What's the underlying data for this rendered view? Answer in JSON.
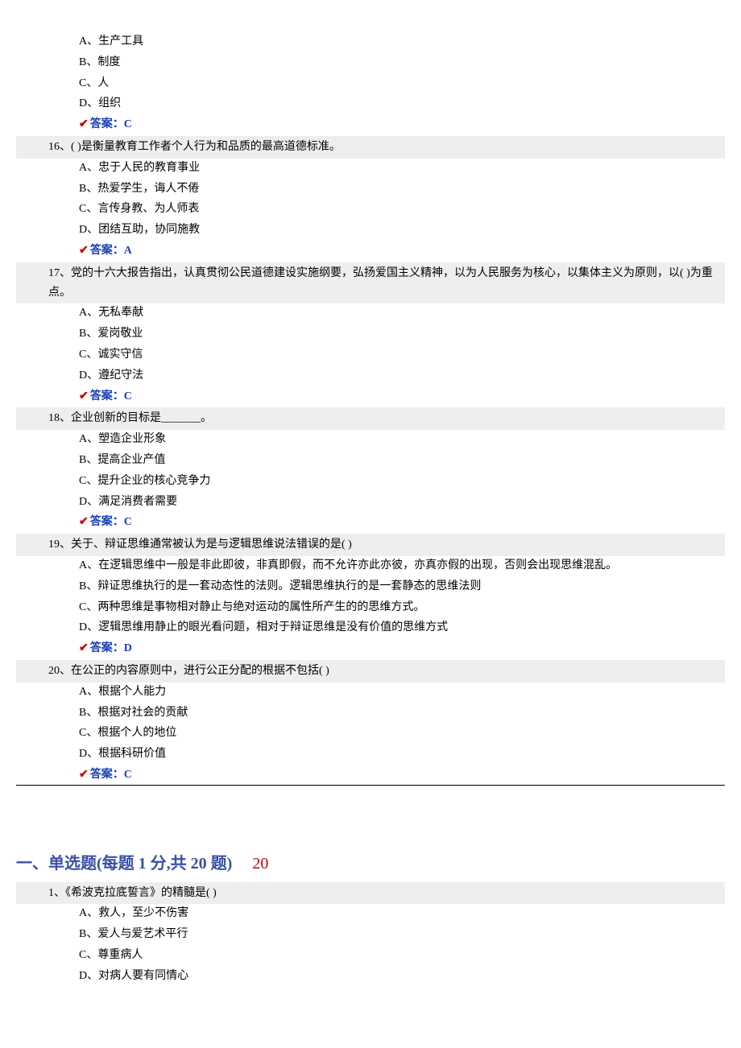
{
  "q15": {
    "options": {
      "A": "A、生产工具",
      "B": "B、制度",
      "C": "C、人",
      "D": "D、组织"
    },
    "answer_label": "答案：C"
  },
  "q16": {
    "stem": "16、(  )是衡量教育工作者个人行为和品质的最高道德标准。",
    "options": {
      "A": "A、忠于人民的教育事业",
      "B": "B、热爱学生，诲人不倦",
      "C": "C、言传身教、为人师表",
      "D": "D、团结互助，协同施教"
    },
    "answer_label": "答案：A"
  },
  "q17": {
    "stem": "17、党的十六大报告指出，认真贯彻公民道德建设实施纲要，弘扬爱国主义精神，以为人民服务为核心，以集体主义为原则，以(  )为重点。",
    "options": {
      "A": "A、无私奉献",
      "B": "B、爱岗敬业",
      "C": "C、诚实守信",
      "D": "D、遵纪守法"
    },
    "answer_label": "答案：C"
  },
  "q18": {
    "stem": "18、企业创新的目标是_______。",
    "options": {
      "A": "A、塑造企业形象",
      "B": "B、提高企业产值",
      "C": "C、提升企业的核心竞争力",
      "D": "D、满足消费者需要"
    },
    "answer_label": "答案：C"
  },
  "q19": {
    "stem": "19、关于、辩证思维通常被认为是与逻辑思维说法错误的是(    )",
    "options": {
      "A": "A、在逻辑思维中一般是非此即彼，非真即假，而不允许亦此亦彼，亦真亦假的出现，否则会出现思维混乱。",
      "B": "B、辩证思维执行的是一套动态性的法则。逻辑思维执行的是一套静态的思维法则",
      "C": "C、两种思维是事物相对静止与绝对运动的属性所产生的的思维方式。",
      "D": "D、逻辑思维用静止的眼光看问题，相对于辩证思维是没有价值的思维方式"
    },
    "answer_label": "答案：D"
  },
  "q20": {
    "stem": "20、在公正的内容原则中，进行公正分配的根据不包括( )",
    "options": {
      "A": "A、根据个人能力",
      "B": "B、根据对社会的贡献",
      "C": "C、根据个人的地位",
      "D": "D、根据科研价值"
    },
    "answer_label": "答案：C"
  },
  "section2": {
    "title_main": "一、单选题(每题 1 分,共 20 题)",
    "title_score": "20"
  },
  "s2q1": {
    "stem": "1、《希波克拉底誓言》的精髓是( )",
    "options": {
      "A": "A、救人，至少不伤害",
      "B": "B、爱人与爱艺术平行",
      "C": "C、尊重病人",
      "D": "D、对病人要有同情心"
    }
  }
}
